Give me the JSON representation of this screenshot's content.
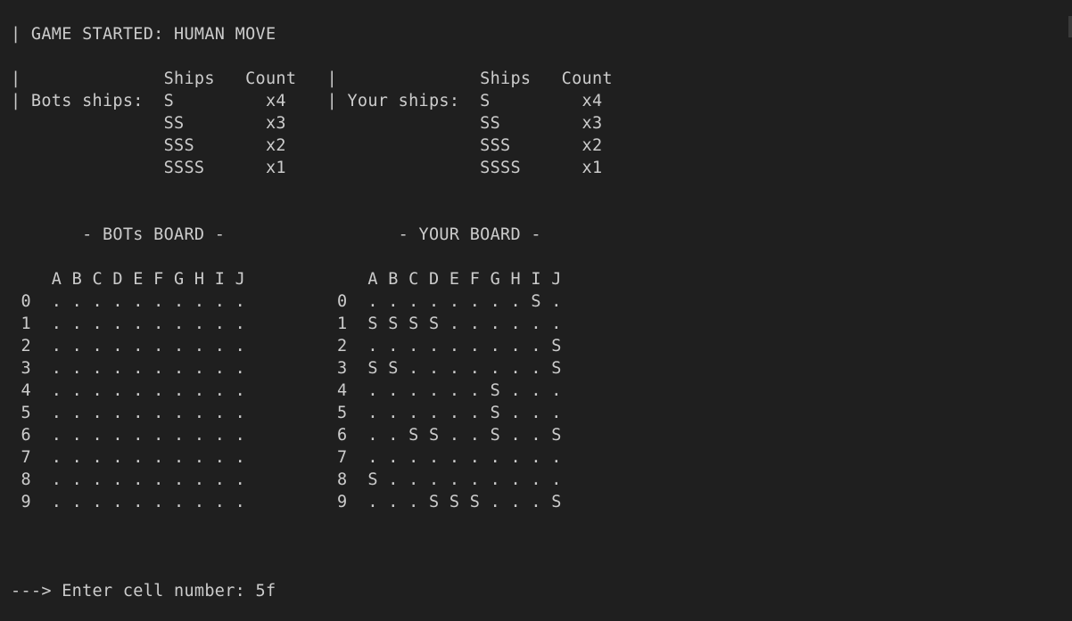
{
  "terminal": {
    "lines": [
      "| GAME STARTED: HUMAN MOVE",
      "",
      "|              Ships   Count   |              Ships   Count",
      "| Bots ships:  S         x4    | Your ships:  S         x4",
      "               SS        x3                   SS        x3",
      "               SSS       x2                   SSS       x2",
      "               SSSS      x1                   SSSS      x1",
      "",
      "",
      "       - BOTs BOARD -                 - YOUR BOARD -",
      "",
      "    A B C D E F G H I J            A B C D E F G H I J",
      " 0  . . . . . . . . . .         0  . . . . . . . . S .",
      " 1  . . . . . . . . . .         1  S S S S . . . . . .",
      " 2  . . . . . . . . . .         2  . . . . . . . . . S",
      " 3  . . . . . . . . . .         3  S S . . . . . . . S",
      " 4  . . . . . . . . . .         4  . . . . . . S . . .",
      " 5  . . . . . . . . . .         5  . . . . . . S . . .",
      " 6  . . . . . . . . . .         6  . . S S . . S . . S",
      " 7  . . . . . . . . . .         7  . . . . . . . . . .",
      " 8  . . . . . . . . . .         8  S . . . . . . . . .",
      " 9  . . . . . . . . . .         9  . . . S S S . . . S",
      "",
      "",
      "",
      "---> Enter cell number: 5f"
    ]
  },
  "colors": {
    "background": "#1f1f1f",
    "text": "#cccccc"
  }
}
